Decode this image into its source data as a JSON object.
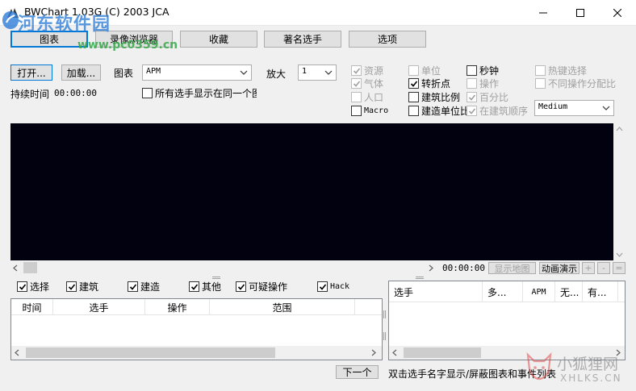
{
  "window": {
    "title": "BWChart 1.03G (C) 2003 JCA"
  },
  "watermark": {
    "site_name": "河东软件园",
    "site_url": "www.pc0359.cn",
    "corner_name": "小狐狸网",
    "corner_url": "XHLKS.CN"
  },
  "tabs": [
    {
      "label": "图表"
    },
    {
      "label": "录像浏览器"
    },
    {
      "label": "收藏"
    },
    {
      "label": "著名选手"
    },
    {
      "label": "选项"
    }
  ],
  "toolbar": {
    "open_label": "打开...",
    "load_label": "加载...",
    "chart_label": "图表",
    "chart_value": "APM",
    "zoom_label": "放大",
    "zoom_value": "1",
    "duration_label": "持续时间",
    "duration_value": "00:00:00",
    "all_players_label": "所有选手显示在同一个图"
  },
  "options": {
    "resources": "资源",
    "gas": "气体",
    "population": "人口",
    "macro": "Macro",
    "units": "单位",
    "turning_points": "转折点",
    "build_ratio": "建筑比例",
    "build_units": "建造单位比",
    "seconds": "秒钟",
    "actions": "操作",
    "percent": "百分比",
    "build_order": "在建筑顺序",
    "hotkey_select": "热键选择",
    "diff_action_ratio": "不同操作分配比",
    "quality_value": "Medium"
  },
  "playback": {
    "time": "00:00:00",
    "show_map_label": "显示地图",
    "animate_label": "动画演示",
    "plus": "+",
    "minus": "-",
    "equals": "="
  },
  "filters": {
    "select": "选择",
    "build": "建筑",
    "train": "建造",
    "other": "其他",
    "suspicious": "可疑操作",
    "hack": "Hack"
  },
  "actions_table": {
    "columns": [
      "时间",
      "选手",
      "操作",
      "范围"
    ]
  },
  "players_table": {
    "columns": [
      "选手",
      "多...",
      "APM",
      "无...",
      "有..."
    ]
  },
  "footer": {
    "next_label": "下一个",
    "hint": "双击选手名字显示/屏蔽图表和事件列表"
  }
}
